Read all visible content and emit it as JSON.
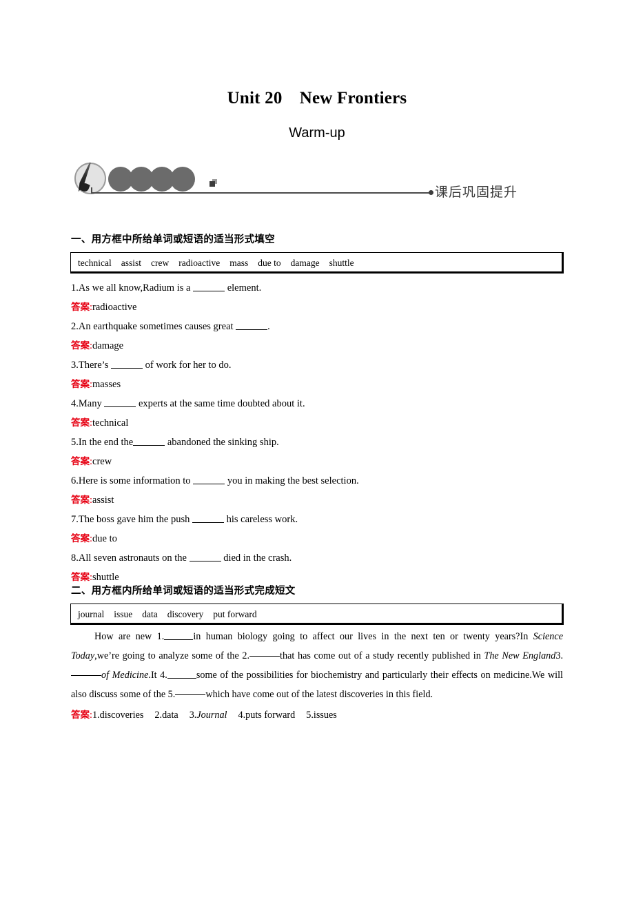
{
  "document": {
    "title": "Unit 20　New Frontiers",
    "subtitle": "Warm-up",
    "banner_label": "课后巩固提升"
  },
  "section1": {
    "heading": "一、用方框中所给单词或短语的适当形式填空",
    "word_bank": [
      "technical",
      "assist",
      "crew",
      "radioactive",
      "mass",
      "due to",
      "damage",
      "shuttle"
    ],
    "items": [
      {
        "number": "1.",
        "before": "As we all know,Radium is a ",
        "after": " element.",
        "answer_label": "答案",
        "answer": "radioactive"
      },
      {
        "number": "2.",
        "before": "An earthquake sometimes causes great ",
        "after": ".",
        "answer_label": "答案",
        "answer": "damage"
      },
      {
        "number": "3.",
        "before": "There’s ",
        "after": " of work for her to do.",
        "answer_label": "答案",
        "answer": "masses"
      },
      {
        "number": "4.",
        "before": "Many ",
        "after": " experts at the same time doubted about it.",
        "answer_label": "答案",
        "answer": "technical"
      },
      {
        "number": "5.",
        "before": "In the end the",
        "after": " abandoned the sinking ship.",
        "answer_label": "答案",
        "answer": "crew"
      },
      {
        "number": "6.",
        "before": "Here is some information to ",
        "after": " you in making the best selection.",
        "answer_label": "答案",
        "answer": "assist"
      },
      {
        "number": "7.",
        "before": "The boss gave him the push ",
        "after": " his careless work.",
        "answer_label": "答案",
        "answer": "due to"
      },
      {
        "number": "8.",
        "before": "All seven astronauts on the ",
        "after": " died in the crash.",
        "answer_label": "答案",
        "answer": "shuttle"
      }
    ]
  },
  "section2": {
    "heading": "二、用方框内所给单词或短语的适当形式完成短文",
    "word_bank": [
      "journal",
      "issue",
      "data",
      "discovery",
      "put forward"
    ],
    "passage": {
      "p1": "How are new 1.",
      "p2": "in human biology going to affect our lives in the next ten or twenty years?In ",
      "italic1": "Science Today",
      "p3": ",we’re going to analyze some of the 2.",
      "p4": "that has come out of a study recently published in ",
      "italic2": "The New England",
      "p5": "3.",
      "italic3": "of Medicine",
      "p6": ".It 4.",
      "p7": "some of the possibilities for biochemistry and particularly their effects on medicine.We will also discuss some of the 5.",
      "p8": "which have come out of the latest discoveries in this field."
    },
    "answer_label": "答案",
    "answers": [
      {
        "num": "1.",
        "text": "discoveries",
        "italic": false
      },
      {
        "num": "2.",
        "text": "data",
        "italic": false
      },
      {
        "num": "3.",
        "text": "Journal",
        "italic": true
      },
      {
        "num": "4.",
        "text": "puts forward",
        "italic": false
      },
      {
        "num": "5.",
        "text": "issues",
        "italic": false
      }
    ]
  },
  "colors": {
    "answer_red": "#e60012",
    "banner_gray": "#6b6b6b",
    "text_black": "#000000"
  }
}
